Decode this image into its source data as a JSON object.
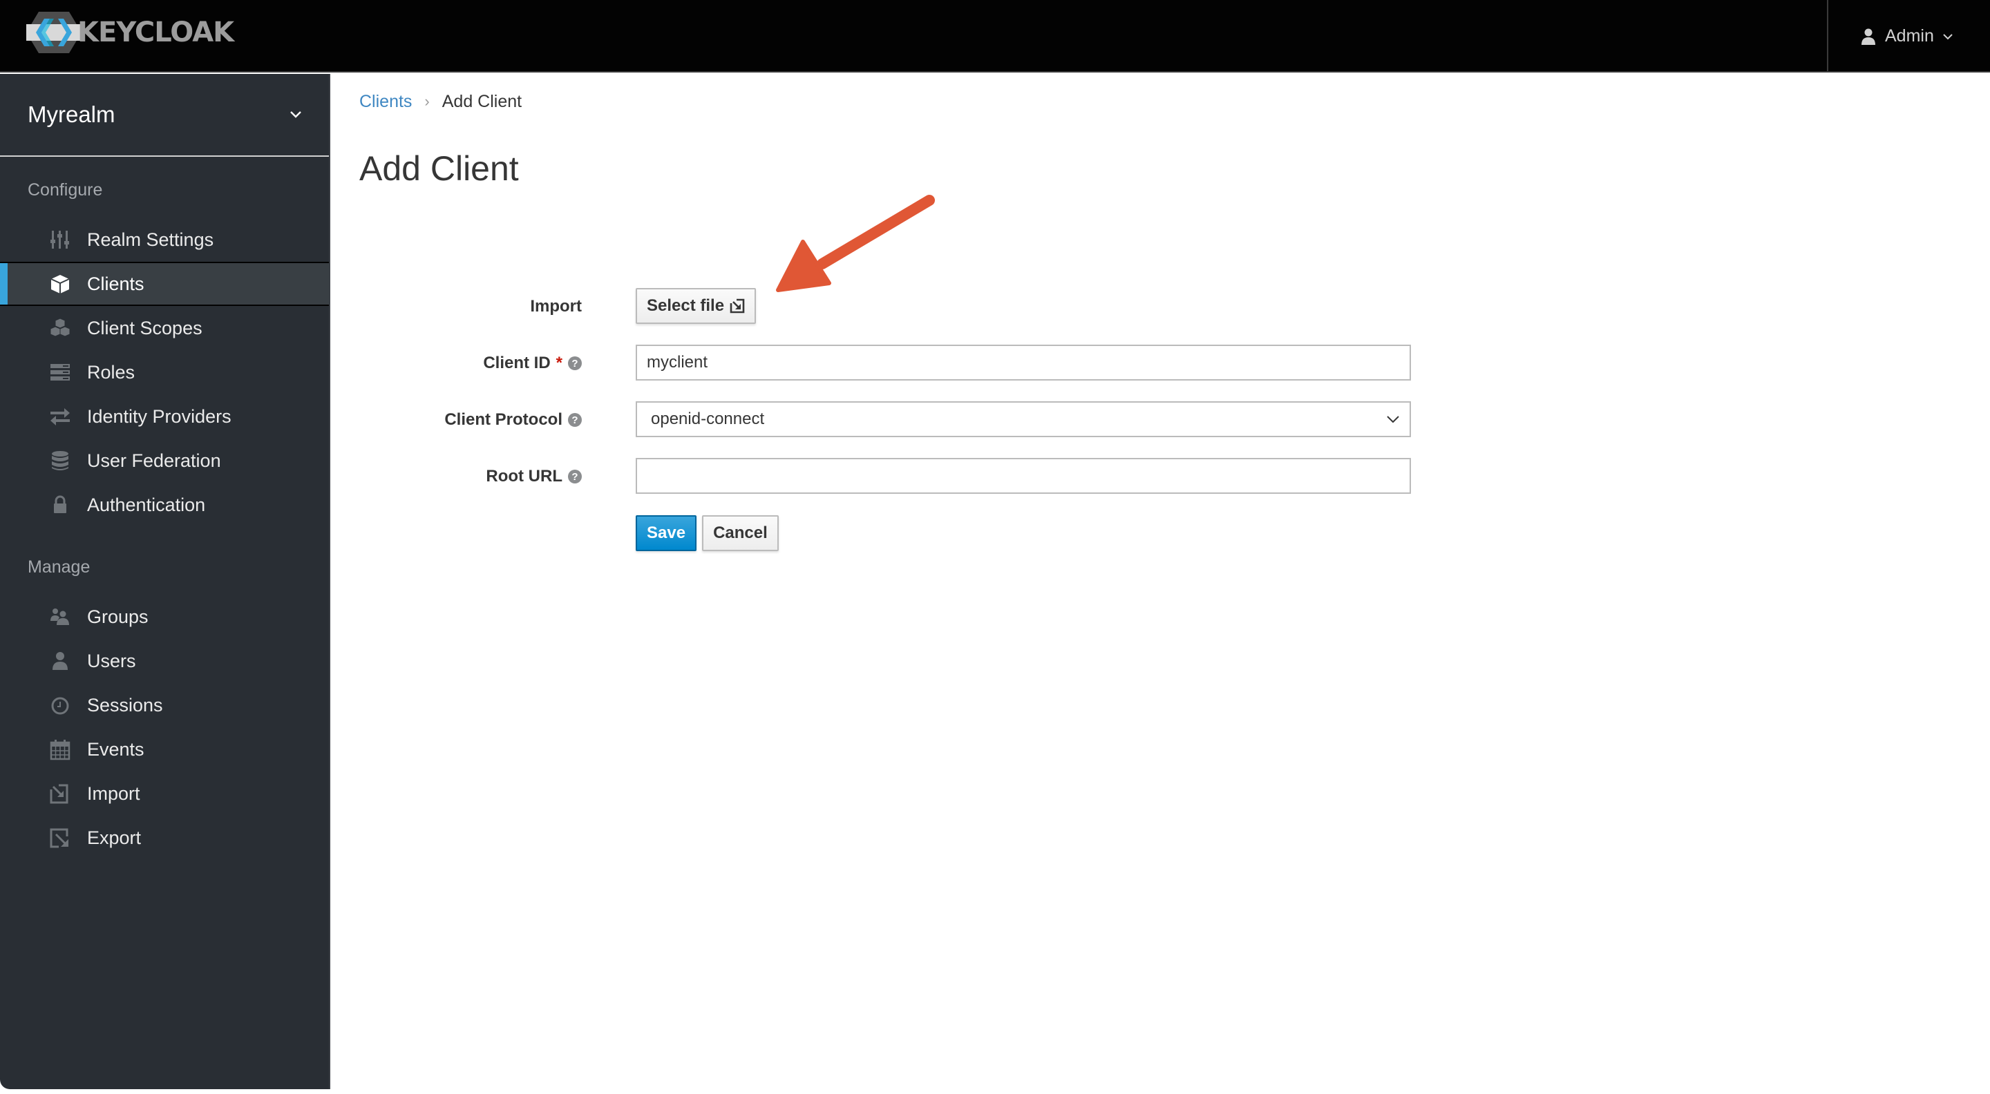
{
  "header": {
    "logo_text": "KEYCLOAK",
    "user_label": "Admin",
    "user_icon": "user-icon",
    "user_caret_icon": "chevron-down-icon"
  },
  "sidebar": {
    "realm": "Myrealm",
    "realm_caret_icon": "chevron-down-icon",
    "sections": {
      "configure": "Configure",
      "manage": "Manage"
    },
    "configure_items": [
      {
        "label": "Realm Settings",
        "icon": "sliders-icon",
        "active": false
      },
      {
        "label": "Clients",
        "icon": "cube-icon",
        "active": true
      },
      {
        "label": "Client Scopes",
        "icon": "cubes-icon",
        "active": false
      },
      {
        "label": "Roles",
        "icon": "server-stack-icon",
        "active": false
      },
      {
        "label": "Identity Providers",
        "icon": "exchange-icon",
        "active": false
      },
      {
        "label": "User Federation",
        "icon": "database-icon",
        "active": false
      },
      {
        "label": "Authentication",
        "icon": "lock-icon",
        "active": false
      }
    ],
    "manage_items": [
      {
        "label": "Groups",
        "icon": "users-icon"
      },
      {
        "label": "Users",
        "icon": "user-icon"
      },
      {
        "label": "Sessions",
        "icon": "clock-icon"
      },
      {
        "label": "Events",
        "icon": "calendar-icon"
      },
      {
        "label": "Import",
        "icon": "import-icon"
      },
      {
        "label": "Export",
        "icon": "export-icon"
      }
    ]
  },
  "breadcrumb": {
    "parent": "Clients",
    "separator": "›",
    "current": "Add Client"
  },
  "page": {
    "title": "Add Client"
  },
  "form": {
    "import_label": "Import",
    "select_file_label": "Select file",
    "client_id_label": "Client ID",
    "client_id_required": "*",
    "client_id_value": "myclient",
    "client_protocol_label": "Client Protocol",
    "client_protocol_value": "openid-connect",
    "root_url_label": "Root URL",
    "root_url_value": "",
    "help_glyph": "?",
    "save_label": "Save",
    "cancel_label": "Cancel"
  },
  "annotation": {
    "arrow_color": "#e05735",
    "points_to": "client-id-input"
  },
  "colors": {
    "masthead": "#030303",
    "sidebar": "#292e34",
    "active_accent": "#39a5dc",
    "link": "#3f87c2",
    "primary": "#0088ce"
  }
}
